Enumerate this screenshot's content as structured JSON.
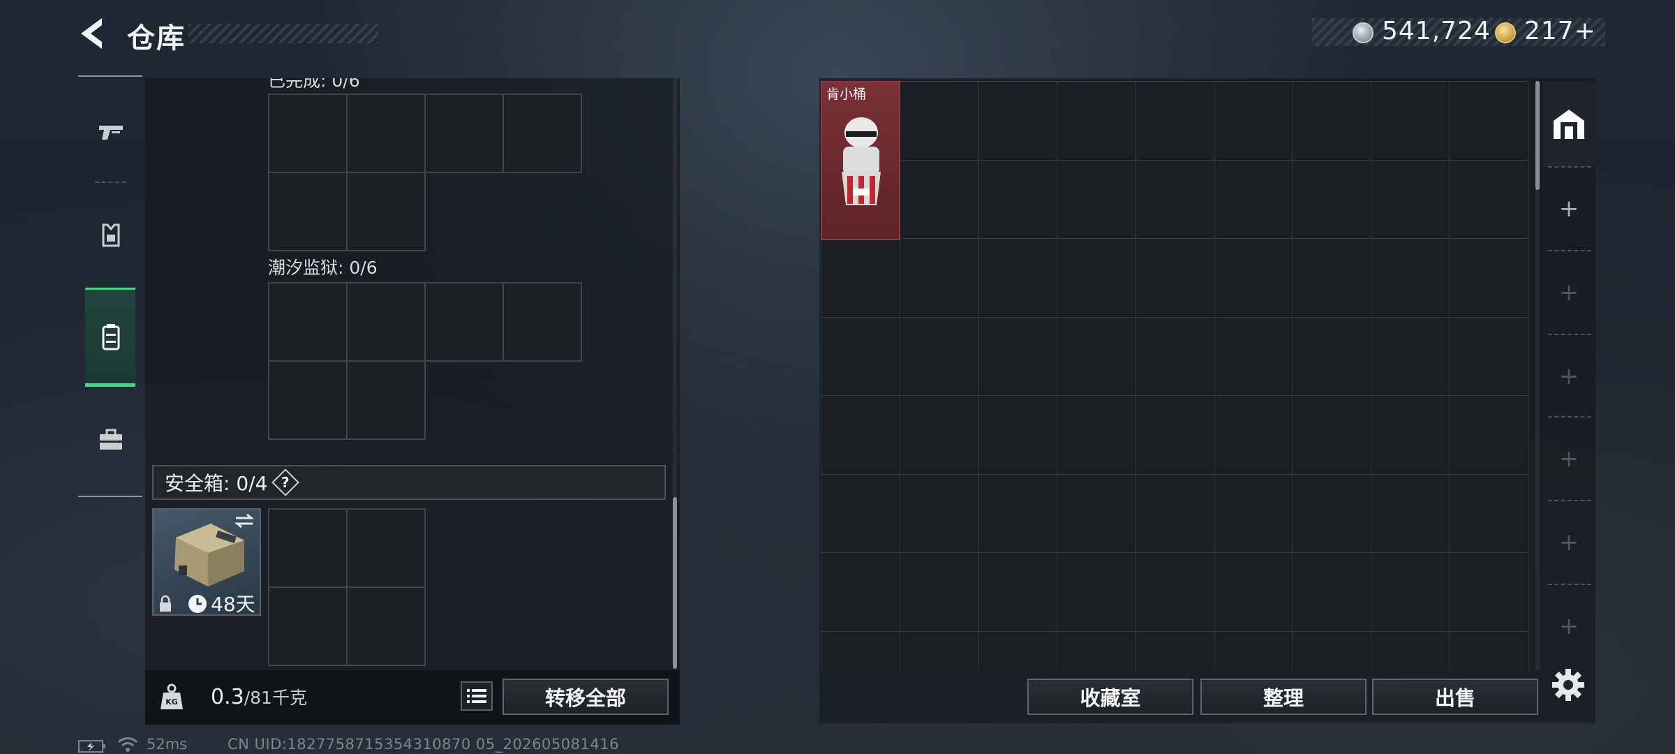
{
  "header": {
    "title": "仓库",
    "currencies": [
      {
        "icon": "silver-coin-icon",
        "value": "541,724"
      },
      {
        "icon": "gold-coin-icon",
        "value": "217+"
      }
    ]
  },
  "nav": {
    "items": [
      {
        "icon": "gun-icon",
        "active": false
      },
      {
        "icon": "armor-vest-icon",
        "active": false
      },
      {
        "icon": "backpack-icon",
        "active": true
      },
      {
        "icon": "toolbox-icon",
        "active": false
      }
    ]
  },
  "left_panel": {
    "partial_label": "已完成: 0/6",
    "section_label": "潮汐监狱: 0/6",
    "safe_box": {
      "label": "安全箱: 0/4",
      "help": "?",
      "days": "48天"
    },
    "weight": {
      "current": "0.3",
      "max": "/81千克"
    },
    "transfer_all": "转移全部"
  },
  "storage": {
    "item": {
      "name": "肯小桶",
      "color": "#7a3036"
    },
    "buttons": {
      "collection": "收藏室",
      "sort": "整理",
      "sell": "出售"
    },
    "tab_plus": "+"
  },
  "status": {
    "ping": "52ms",
    "uid": "CN UID:1827758715354310870 05_202605081416"
  },
  "colors": {
    "accent_active": "#3fd884",
    "item_highlight": "#7a3036"
  }
}
